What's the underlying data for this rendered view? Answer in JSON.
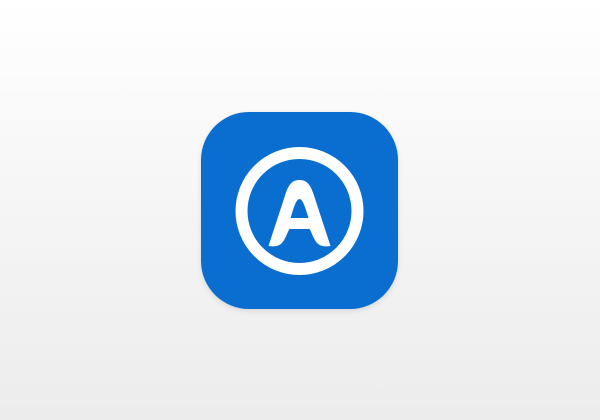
{
  "app_icon": {
    "icon": "circled-letter-a-logo",
    "background_color": "#0A6ED1",
    "foreground_color": "#FFFFFF",
    "page_background": "#F0F0F0"
  }
}
